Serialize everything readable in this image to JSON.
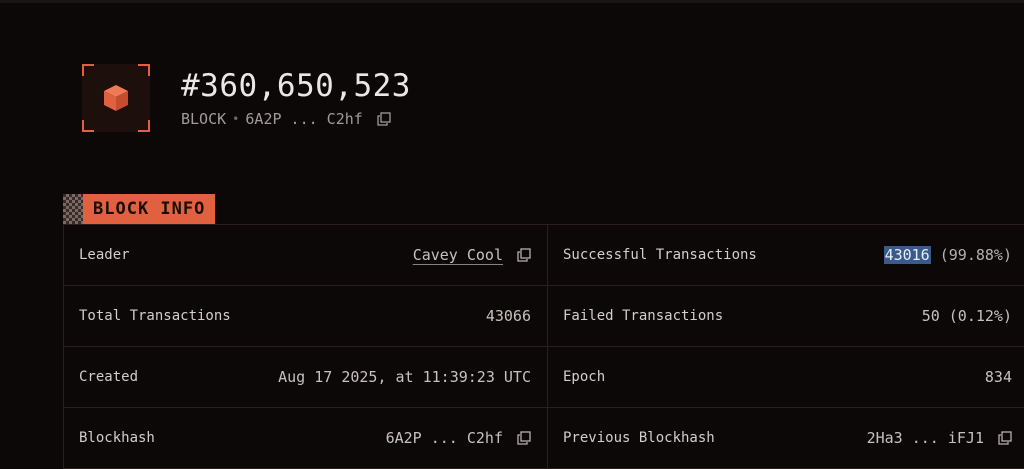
{
  "header": {
    "block_number": "#360,650,523",
    "kind": "BLOCK",
    "hash_short": "6A2P ... C2hf"
  },
  "section": {
    "title": "BLOCK INFO"
  },
  "rows": {
    "leader": {
      "label": "Leader",
      "value": "Cavey Cool"
    },
    "successful": {
      "label": "Successful Transactions",
      "count": "43016",
      "percent": "(99.88%)"
    },
    "total": {
      "label": "Total Transactions",
      "value": "43066"
    },
    "failed": {
      "label": "Failed Transactions",
      "value": "50 (0.12%)"
    },
    "created": {
      "label": "Created",
      "value": "Aug 17 2025, at 11:39:23 UTC"
    },
    "epoch": {
      "label": "Epoch",
      "value": "834"
    },
    "blockhash": {
      "label": "Blockhash",
      "value": "6A2P ... C2hf"
    },
    "previous": {
      "label": "Previous Blockhash",
      "value": "2Ha3 ... iFJ1"
    }
  },
  "colors": {
    "accent": "#e0603f",
    "background": "#0c0808",
    "selection": "#3b5a8c"
  },
  "icons": [
    "cube-icon",
    "copy-icon"
  ]
}
